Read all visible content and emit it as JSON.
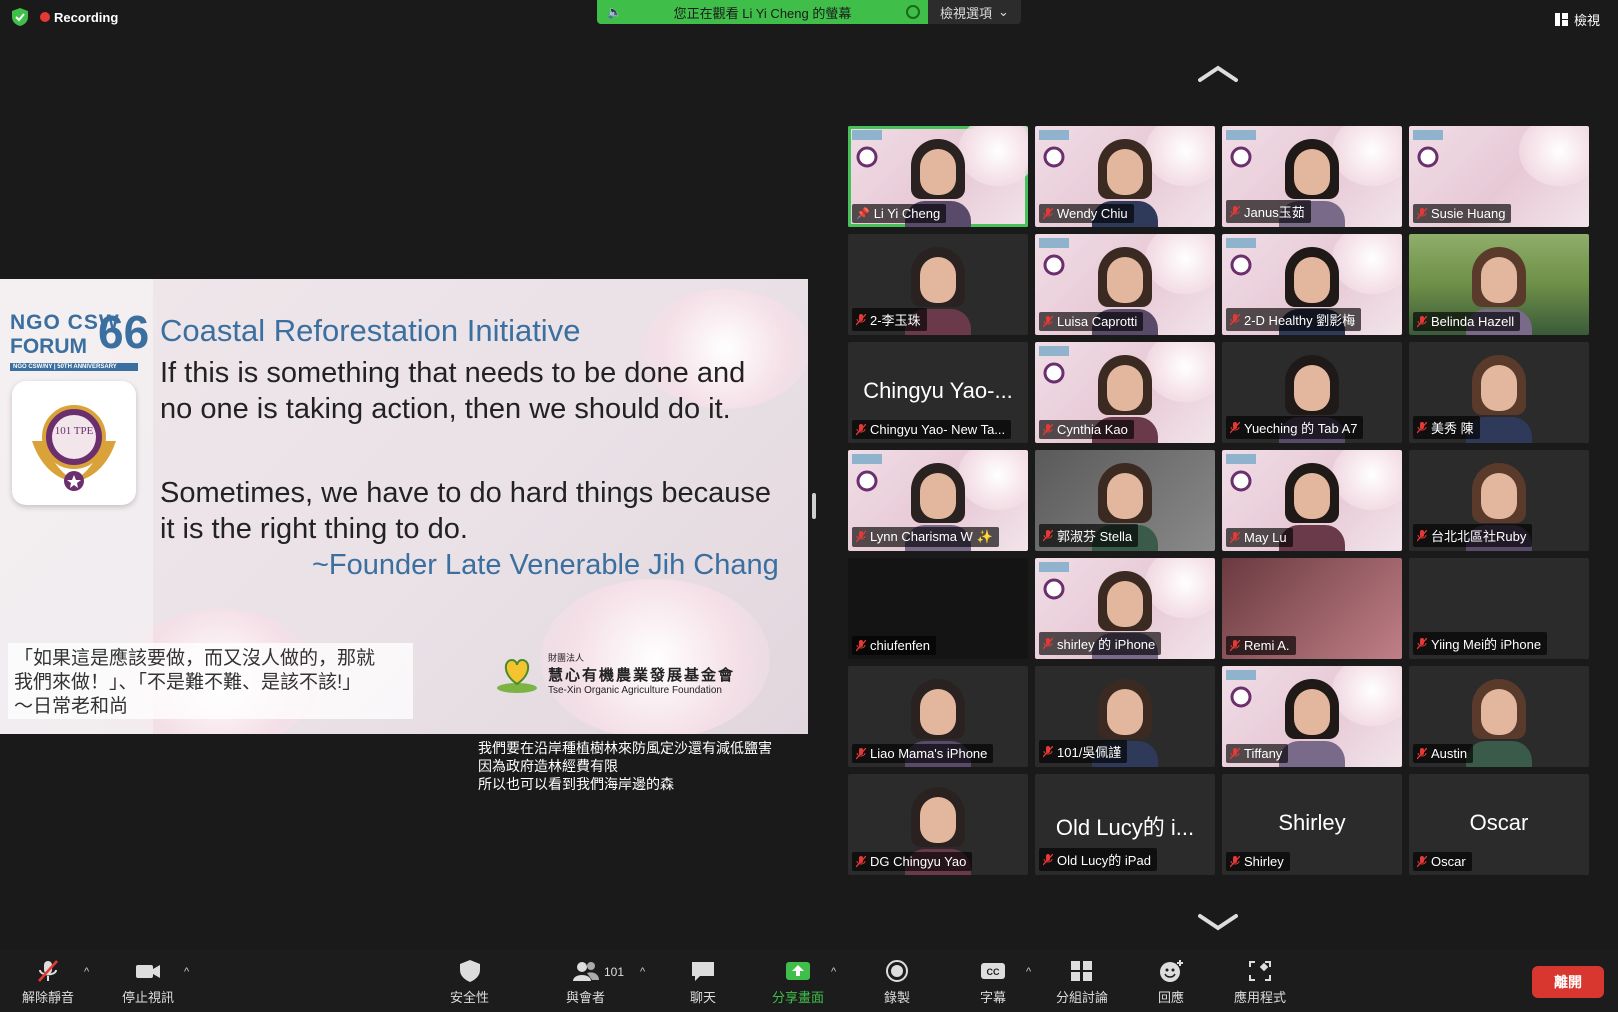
{
  "top": {
    "recording_label": "Recording",
    "share_banner_text": "您正在觀看 Li Yi Cheng 的螢幕",
    "view_options_label": "檢視選項",
    "view_label": "檢視"
  },
  "slide": {
    "logo_line1": "NGO CSW",
    "logo_line2": "FORUM",
    "logo_number": "66",
    "logo_subtitle": "NGO CSW/NY | 50TH ANNIVERSARY",
    "badge_text": "101 TPE",
    "title": "Coastal Reforestation Initiative",
    "quote1": "If this is something that needs to be done and no one is taking action, then we should do it.",
    "quote2": "Sometimes, we have to do hard things because it is the right thing to do.",
    "author": "~Founder Late Venerable Jih Chang",
    "zh_quote_line1": "「如果這是應該要做，而又沒人做的，那就",
    "zh_quote_line2": "我們來做！」、「不是難不難、是該不該!」",
    "zh_quote_line3": "～日常老和尚",
    "foundation_small": "財團法人",
    "foundation_zh": "慧心有機農業發展基金會",
    "foundation_en": "Tse-Xin Organic Agriculture Foundation"
  },
  "captions": [
    "我們要在沿岸種植樹林來防風定沙還有減低鹽害",
    "因為政府造林經費有限",
    "所以也可以看到我們海岸邊的森"
  ],
  "participants": [
    {
      "name": "Li Yi Cheng",
      "bg": "pink",
      "video": "face",
      "active": true
    },
    {
      "name": "Wendy Chiu",
      "bg": "pink",
      "video": "face"
    },
    {
      "name": "Janus玉茹",
      "bg": "pink",
      "video": "face"
    },
    {
      "name": "Susie Huang",
      "bg": "pink",
      "video": "none"
    },
    {
      "name": "2-李玉珠",
      "bg": "dark",
      "video": "face"
    },
    {
      "name": "Luisa Caprotti",
      "bg": "pink",
      "video": "face"
    },
    {
      "name": "2-D Healthy 劉影梅",
      "bg": "pink",
      "video": "face"
    },
    {
      "name": "Belinda Hazell",
      "bg": "landscape",
      "video": "face"
    },
    {
      "name": "Chingyu Yao- New Ta...",
      "bg": "dark",
      "video": "text",
      "big_text": "Chingyu Yao-..."
    },
    {
      "name": "Cynthia Kao",
      "bg": "pink",
      "video": "face"
    },
    {
      "name": "Yueching 的 Tab A7",
      "bg": "dark",
      "video": "face"
    },
    {
      "name": "美秀 陳",
      "bg": "dark",
      "video": "face"
    },
    {
      "name": "Lynn Charisma W ✨",
      "bg": "pink",
      "video": "face"
    },
    {
      "name": "郭淑芬 Stella",
      "bg": "gray",
      "video": "face"
    },
    {
      "name": "May Lu",
      "bg": "pink",
      "video": "face"
    },
    {
      "name": "台北北區社Ruby",
      "bg": "dark",
      "video": "face"
    },
    {
      "name": "chiufenfen",
      "bg": "black",
      "video": "none"
    },
    {
      "name": "shirley 的 iPhone",
      "bg": "pink",
      "video": "face"
    },
    {
      "name": "Remi A.",
      "bg": "rose",
      "video": "none"
    },
    {
      "name": "Yiing Mei的 iPhone",
      "bg": "dark",
      "video": "none"
    },
    {
      "name": "Liao Mama's iPhone",
      "bg": "dark",
      "video": "face"
    },
    {
      "name": "101/吳佩謹",
      "bg": "dark",
      "video": "face"
    },
    {
      "name": "Tiffany",
      "bg": "pink",
      "video": "face"
    },
    {
      "name": "Austin",
      "bg": "dark",
      "video": "face"
    },
    {
      "name": "DG Chingyu Yao",
      "bg": "dark",
      "video": "face"
    },
    {
      "name": "Old Lucy的 iPad",
      "bg": "dark",
      "video": "text",
      "big_text": "Old Lucy的 i..."
    },
    {
      "name": "Shirley",
      "bg": "dark",
      "video": "text",
      "big_text": "Shirley"
    },
    {
      "name": "Oscar",
      "bg": "dark",
      "video": "text",
      "big_text": "Oscar"
    }
  ],
  "toolbar": {
    "unmute": "解除靜音",
    "stop_video": "停止視訊",
    "security": "安全性",
    "participants": "與會者",
    "participant_count": "101",
    "chat": "聊天",
    "share_screen": "分享畫面",
    "record": "錄製",
    "captions": "字幕",
    "breakout": "分組討論",
    "reactions": "回應",
    "apps": "應用程式",
    "leave": "離開"
  },
  "colors": {
    "share_green": "#3fbf4a",
    "leave_red": "#d7372f",
    "active_border": "#47c25a",
    "slide_blue": "#3a6fa0"
  }
}
